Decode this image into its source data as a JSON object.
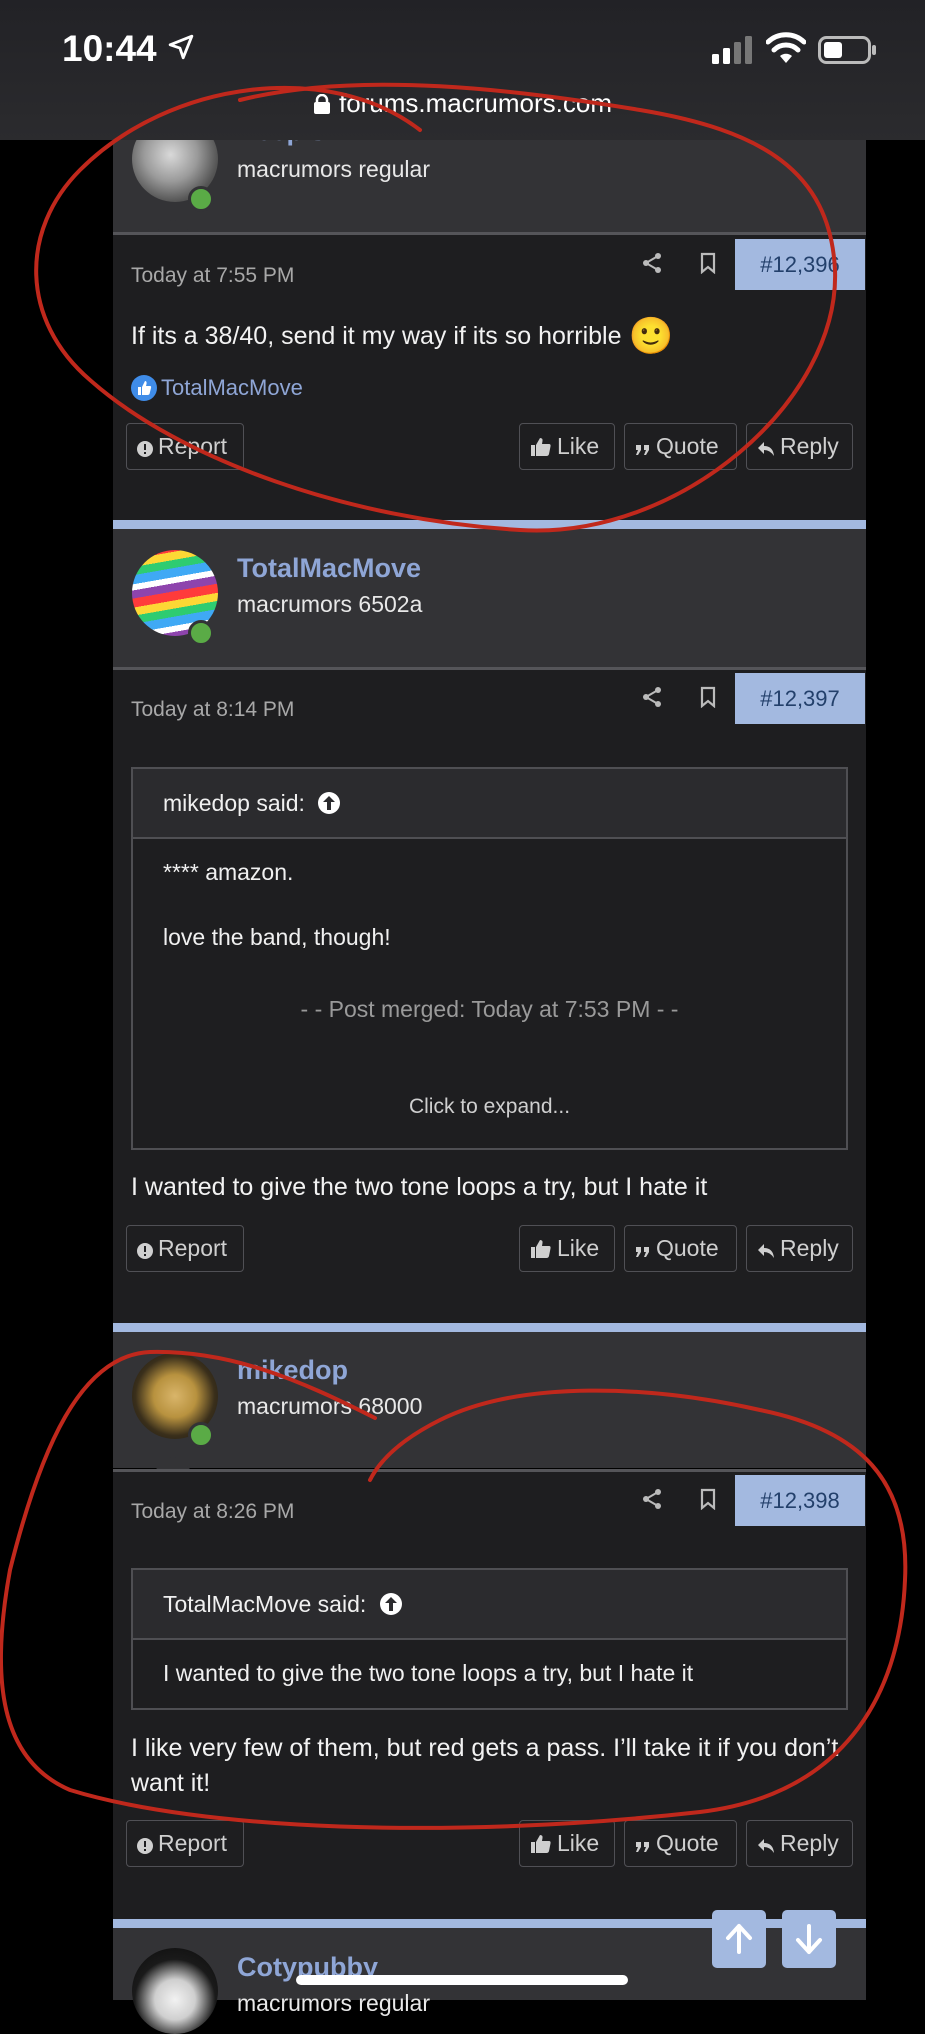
{
  "status_bar": {
    "time": "10:44",
    "url": "forums.macrumors.com"
  },
  "posts": [
    {
      "username": "Deepish",
      "user_title": "macrumors regular",
      "date": "Today at 7:55 PM",
      "post_number": "#12,396",
      "message": "If its a 38/40, send it my way if its so horrible",
      "emoji": "🙂",
      "liked_by": "TotalMacMove"
    },
    {
      "username": "TotalMacMove",
      "user_title": "macrumors 6502a",
      "date": "Today at 8:14 PM",
      "post_number": "#12,397",
      "quote": {
        "author": "mikedop said:",
        "line1": "**** amazon.",
        "line2": "love the band, though!",
        "merged": "- - Post merged: Today at 7:53 PM - -",
        "expand": "Click to expand..."
      },
      "message": "I wanted to give the two tone loops a try, but I hate it"
    },
    {
      "username": "mikedop",
      "user_title": "macrumors 68000",
      "date": "Today at 8:26 PM",
      "post_number": "#12,398",
      "quote": {
        "author": "TotalMacMove said:",
        "line1": "I wanted to give the two tone loops a try, but I hate it"
      },
      "message": "I like very few of them, but red gets a pass. I’ll take it if you don’t want it!"
    },
    {
      "username": "Cotypubby",
      "user_title": "macrumors regular"
    }
  ],
  "actions": {
    "report": "Report",
    "like": "Like",
    "quote": "Quote",
    "reply": "Reply"
  },
  "colors": {
    "accent": "#a3b9e0",
    "username": "#8fa6d6",
    "online": "#5aab46",
    "annotation": "#c0281c"
  }
}
